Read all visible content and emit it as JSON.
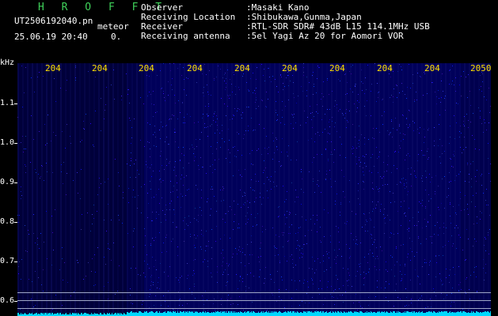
{
  "header": {
    "brand": "H R O F F T",
    "filename": "UT2506192040.pn",
    "meteor_label": "meteor",
    "datetime": "25.06.19 20:40",
    "count": "0."
  },
  "meta": [
    {
      "label": "Observer",
      "value": ":Masaki Kano"
    },
    {
      "label": "Receiving Location",
      "value": ":Shibukawa,Gunma,Japan"
    },
    {
      "label": "Receiver",
      "value": ":RTL-SDR SDR# 43dB L15 114.1MHz USB"
    },
    {
      "label": "Receiving antenna",
      "value": ":5el Yagi Az 20 for Aomori VOR"
    }
  ],
  "axis": {
    "unit": "kHz",
    "y_ticks": [
      "1.1",
      "1.0",
      "0.9",
      "0.8",
      "0.7",
      "0.6"
    ],
    "x_ticks": [
      "204",
      "204",
      "204",
      "204",
      "204",
      "204",
      "204",
      "204",
      "204",
      "2050"
    ]
  },
  "colors": {
    "background": "#000000",
    "noise": "#1a1aa0",
    "signal": "#00d8ff",
    "tick_labels": "#ffe000",
    "brand": "#3fd15a"
  }
}
